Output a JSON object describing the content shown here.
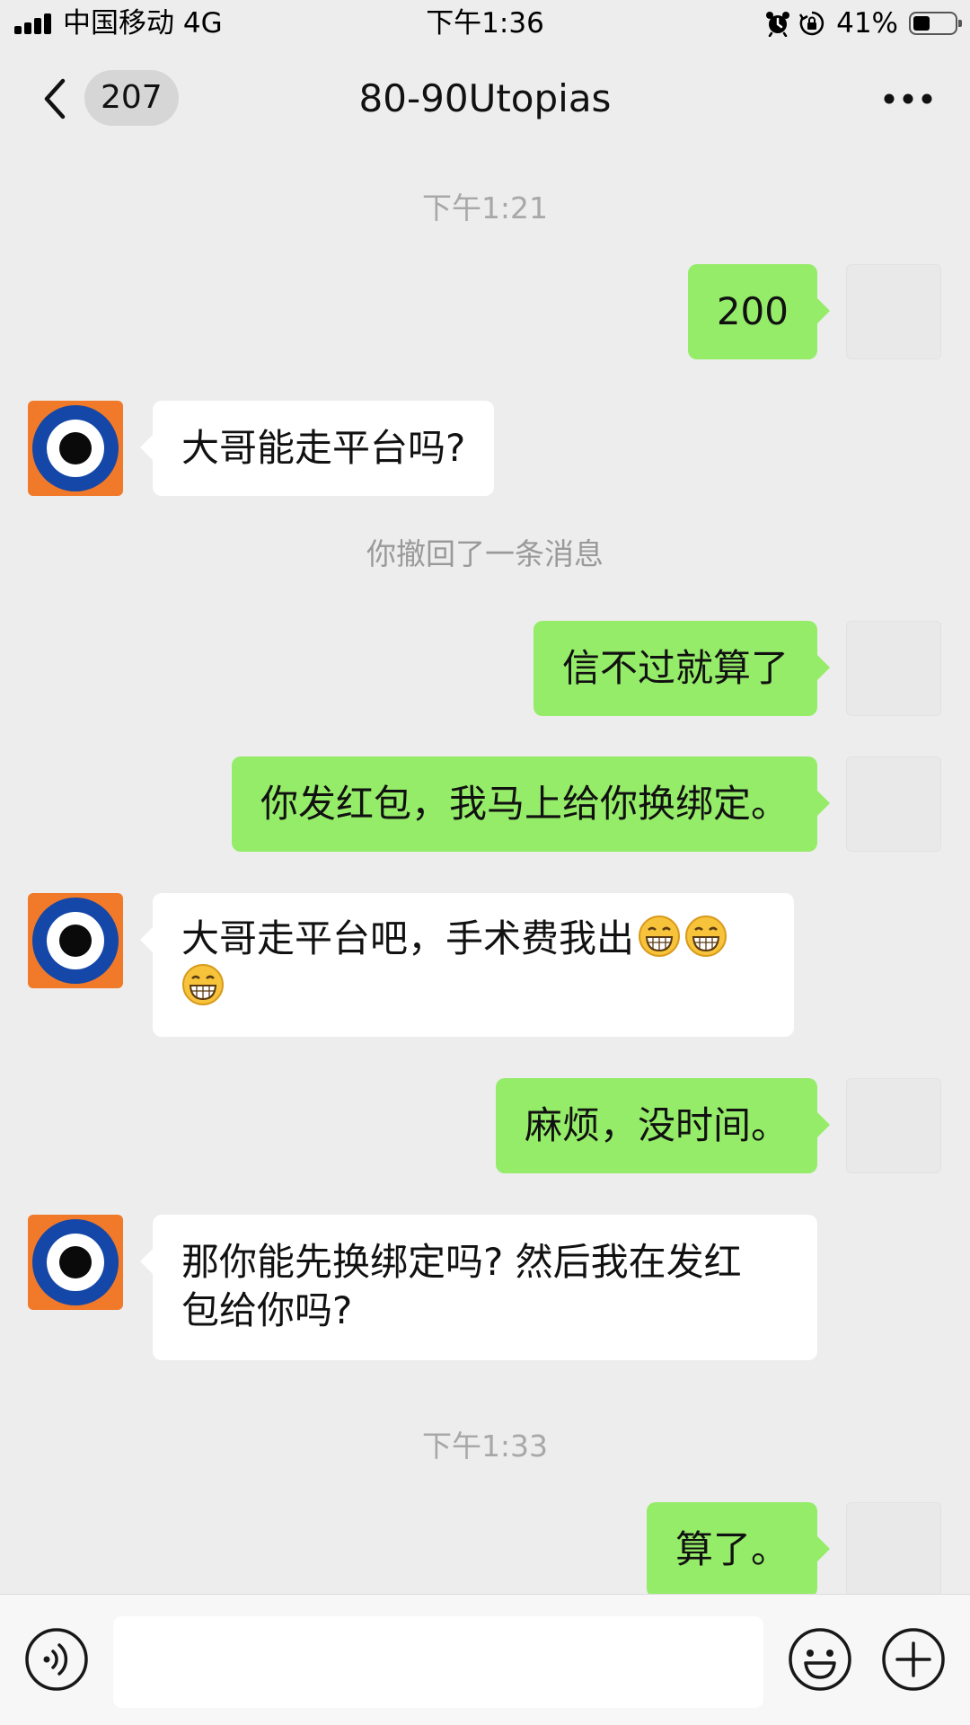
{
  "status_bar": {
    "carrier": "中国移动 4G",
    "time": "下午1:36",
    "battery_percent": "41%",
    "battery_level": 0.41,
    "icons": [
      "signal-icon",
      "alarm-icon",
      "rotation-lock-icon",
      "battery-icon"
    ]
  },
  "nav": {
    "back_icon": "chevron-left-icon",
    "unread_count": "207",
    "title": "80-90Utopias",
    "more_icon": "more-dots-icon"
  },
  "messages": [
    {
      "kind": "time",
      "text": "下午1:21"
    },
    {
      "kind": "msg",
      "from": "me",
      "text": "200"
    },
    {
      "kind": "msg",
      "from": "them",
      "text": "大哥能走平台吗?"
    },
    {
      "kind": "system",
      "text": "你撤回了一条消息"
    },
    {
      "kind": "msg",
      "from": "me",
      "text": "信不过就算了"
    },
    {
      "kind": "msg",
      "from": "me",
      "text": "你发红包，我马上给你换绑定。"
    },
    {
      "kind": "msg",
      "from": "them",
      "text": "大哥走平台吧，手术费我出",
      "emoji": [
        "grin-emoji",
        "grin-emoji",
        "grin-emoji"
      ]
    },
    {
      "kind": "msg",
      "from": "me",
      "text": "麻烦，没时间。"
    },
    {
      "kind": "msg",
      "from": "them",
      "line1": "那你能先换绑定吗? 然后我在发红",
      "line2": "包给你吗?"
    },
    {
      "kind": "time",
      "text": "下午1:33"
    },
    {
      "kind": "msg",
      "from": "me",
      "text": "算了。"
    }
  ],
  "input": {
    "voice_icon": "voice-icon",
    "placeholder": "",
    "value": "",
    "emoji_icon": "emoji-icon",
    "plus_icon": "plus-icon"
  },
  "colors": {
    "background": "#ededed",
    "my_bubble": "#95ec69",
    "their_bubble": "#ffffff",
    "avatar_orange": "#f07a29",
    "avatar_blue": "#1447a8"
  }
}
